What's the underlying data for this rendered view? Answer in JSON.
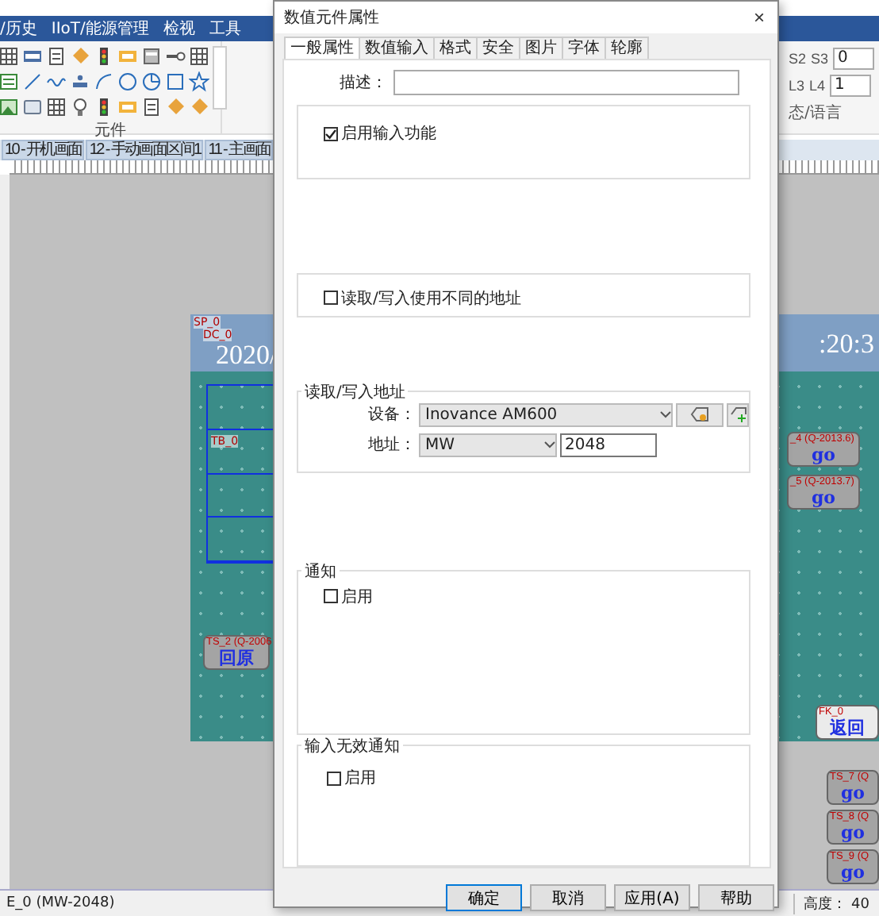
{
  "app": {
    "menu": [
      "/历史",
      "IIoT/能源管理",
      "检视",
      "工具"
    ],
    "ribbon": {
      "group_label": "元件",
      "spin_rows": [
        {
          "labels": [
            "S2",
            "S3"
          ],
          "value": "0"
        },
        {
          "labels": [
            "L3",
            "L4"
          ],
          "value": "1"
        }
      ],
      "right_group_label": "态/语言"
    },
    "tabs": [
      {
        "label": "10 - 开机画面",
        "selected": false
      },
      {
        "label": "12 - 手动画面区间1",
        "selected": false
      },
      {
        "label": "11 - 主画面",
        "selected": false
      }
    ],
    "canvas": {
      "tags": [
        "SP_0",
        "DC_0"
      ],
      "date": "2020/",
      "time": ":20:3",
      "table_tag": "TB_0",
      "buttons": [
        {
          "tag": "TS_2 (Q-2006",
          "text": "回原"
        },
        {
          "tag": "_4 (Q-2013.6)",
          "text": "go"
        },
        {
          "tag": "_5 (Q-2013.7)",
          "text": "go"
        },
        {
          "tag": "FK_0",
          "text": "返回"
        },
        {
          "tag": "TS_7 (Q",
          "text": "go"
        },
        {
          "tag": "TS_8 (Q",
          "text": "go"
        },
        {
          "tag": "TS_9 (Q",
          "text": "go"
        }
      ]
    },
    "status_bar": {
      "left": "E_0 (MW-2048)",
      "right": "高度： 40"
    }
  },
  "dialog": {
    "title": "数值元件属性",
    "close": "×",
    "tabs": [
      {
        "label": "一般属性",
        "selected": true
      },
      {
        "label": "数值输入",
        "selected": false
      },
      {
        "label": "格式",
        "selected": false
      },
      {
        "label": "安全",
        "selected": false
      },
      {
        "label": "图片",
        "selected": false
      },
      {
        "label": "字体",
        "selected": false
      },
      {
        "label": "轮廓",
        "selected": false
      }
    ],
    "description_label": "描述：",
    "enable_input": {
      "label": "启用输入功能",
      "checked": true
    },
    "different_address": {
      "label": "读取/写入使用不同的地址",
      "checked": false
    },
    "address_group": {
      "title": "读取/写入地址",
      "device_label": "设备：",
      "device": "Inovance AM600",
      "address_label": "地址：",
      "area": "MW",
      "address": "2048"
    },
    "notify": {
      "title": "通知",
      "label": "启用",
      "checked": false
    },
    "invalid_notify": {
      "title": "输入无效通知",
      "label": "启用",
      "checked": false
    },
    "buttons": [
      "确定",
      "取消",
      "应用(A)",
      "帮助"
    ]
  }
}
